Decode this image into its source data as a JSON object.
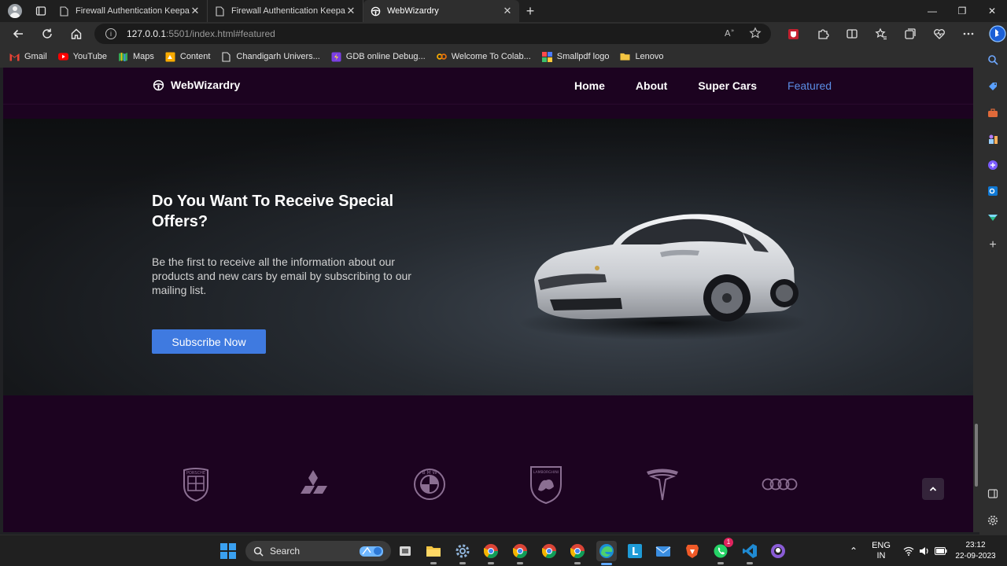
{
  "tabs": [
    {
      "title": "Firewall Authentication Keepalive",
      "active": false
    },
    {
      "title": "Firewall Authentication Keepalive",
      "active": false
    },
    {
      "title": "WebWizardry",
      "active": true
    }
  ],
  "address_bar": {
    "host": "127.0.0.1",
    "rest": ":5501/index.html#featured"
  },
  "bookmarks": [
    {
      "label": "Gmail",
      "icon": "gmail-icon"
    },
    {
      "label": "YouTube",
      "icon": "youtube-icon"
    },
    {
      "label": "Maps",
      "icon": "maps-icon"
    },
    {
      "label": "Content",
      "icon": "content-icon"
    },
    {
      "label": "Chandigarh Univers...",
      "icon": "page-icon"
    },
    {
      "label": "GDB online Debug...",
      "icon": "gdb-icon"
    },
    {
      "label": "Welcome To Colab...",
      "icon": "colab-icon"
    },
    {
      "label": "Smallpdf logo",
      "icon": "smallpdf-icon"
    },
    {
      "label": "Lenovo",
      "icon": "folder-icon"
    }
  ],
  "site": {
    "brand": "WebWizardry",
    "menu": [
      {
        "label": "Home",
        "active": false
      },
      {
        "label": "About",
        "active": false
      },
      {
        "label": "Super Cars",
        "active": false
      },
      {
        "label": "Featured",
        "active": true
      }
    ],
    "hero": {
      "title": "Do You Want To Receive Special Offers?",
      "text": "Be the first to receive all the information about our products and new cars by email by subscribing to our mailing list.",
      "button": "Subscribe Now"
    },
    "brands": [
      "porsche-logo-icon",
      "mitsubishi-logo-icon",
      "bmw-logo-icon",
      "lamborghini-logo-icon",
      "tesla-logo-icon",
      "audi-logo-icon"
    ]
  },
  "taskbar": {
    "search_placeholder": "Search",
    "language": "ENG",
    "region": "IN",
    "time": "23:12",
    "date": "22-09-2023",
    "whatsapp_badge": "1"
  },
  "colors": {
    "page_bg": "#1c0320",
    "accent": "#3f7ae0",
    "nav_active": "#5b8ee6"
  }
}
